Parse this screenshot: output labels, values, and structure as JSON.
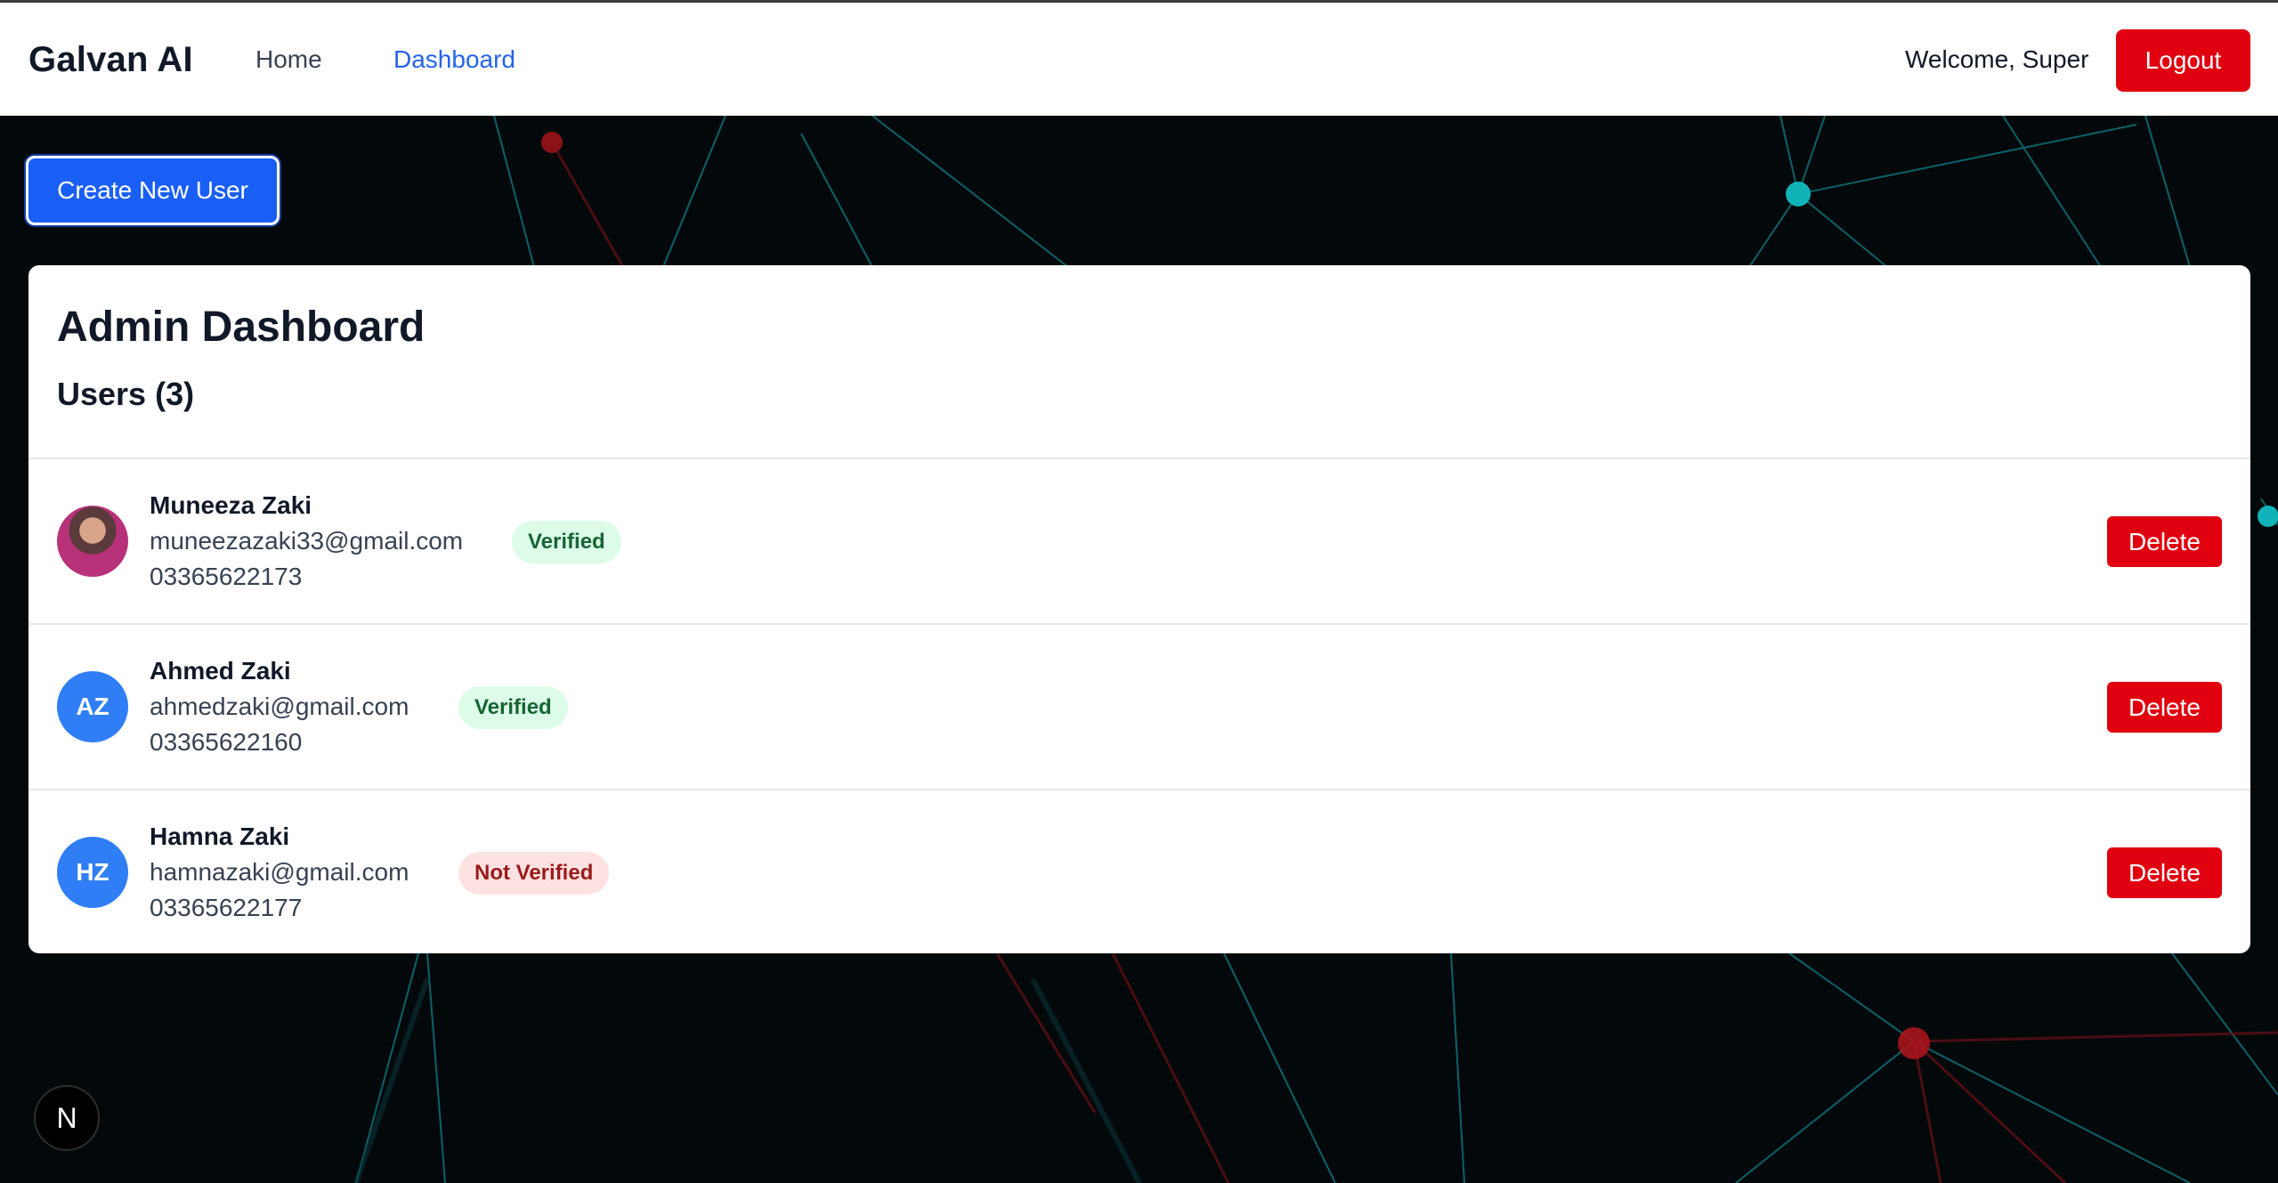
{
  "header": {
    "brand": "Galvan AI",
    "nav": {
      "home": "Home",
      "dashboard": "Dashboard"
    },
    "welcome": "Welcome, Super",
    "logout_label": "Logout"
  },
  "actions": {
    "create_user_label": "Create New User"
  },
  "dashboard": {
    "title": "Admin Dashboard",
    "users_heading": "Users (3)",
    "delete_label": "Delete",
    "users": [
      {
        "name": "Muneeza Zaki",
        "email": "muneezazaki33@gmail.com",
        "phone": "03365622173",
        "status": "Verified",
        "avatar": "photo"
      },
      {
        "name": "Ahmed Zaki",
        "email": "ahmedzaki@gmail.com",
        "phone": "03365622160",
        "status": "Verified",
        "initials": "AZ"
      },
      {
        "name": "Hamna Zaki",
        "email": "hamnazaki@gmail.com",
        "phone": "03365622177",
        "status": "Not Verified",
        "initials": "HZ"
      }
    ]
  },
  "dev_badge": {
    "letter": "N"
  },
  "colors": {
    "accent": "#1a5ff5",
    "danger": "#e0000f",
    "link_active": "#2563eb",
    "avatar_bg": "#2f7ef5",
    "verified_bg": "#dcfce7",
    "verified_text": "#166534",
    "unverified_bg": "#fee2e2",
    "unverified_text": "#991b1b",
    "background": "#03090b"
  }
}
